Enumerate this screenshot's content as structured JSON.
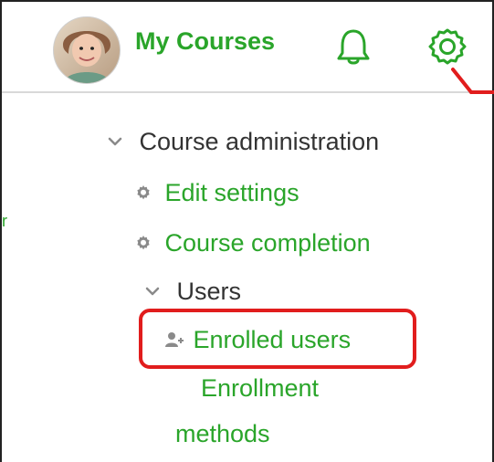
{
  "header": {
    "brand": "My Courses",
    "avatar_icon": "user-avatar",
    "bell_icon": "bell-icon",
    "gear_icon": "gear-icon",
    "accent": "#2aa52a"
  },
  "left_fragment": "r",
  "menu": {
    "course_admin_label": "Course administration",
    "items": [
      {
        "label": "Edit settings",
        "icon": "gear-icon"
      },
      {
        "label": "Course completion",
        "icon": "gear-icon"
      }
    ],
    "users_label": "Users",
    "users_items": [
      {
        "label": "Enrolled users",
        "icon": "user-plus-icon"
      },
      {
        "label": "Enrollment"
      },
      {
        "label": "methods"
      }
    ]
  },
  "callout": {
    "color": "#e11d1d"
  }
}
